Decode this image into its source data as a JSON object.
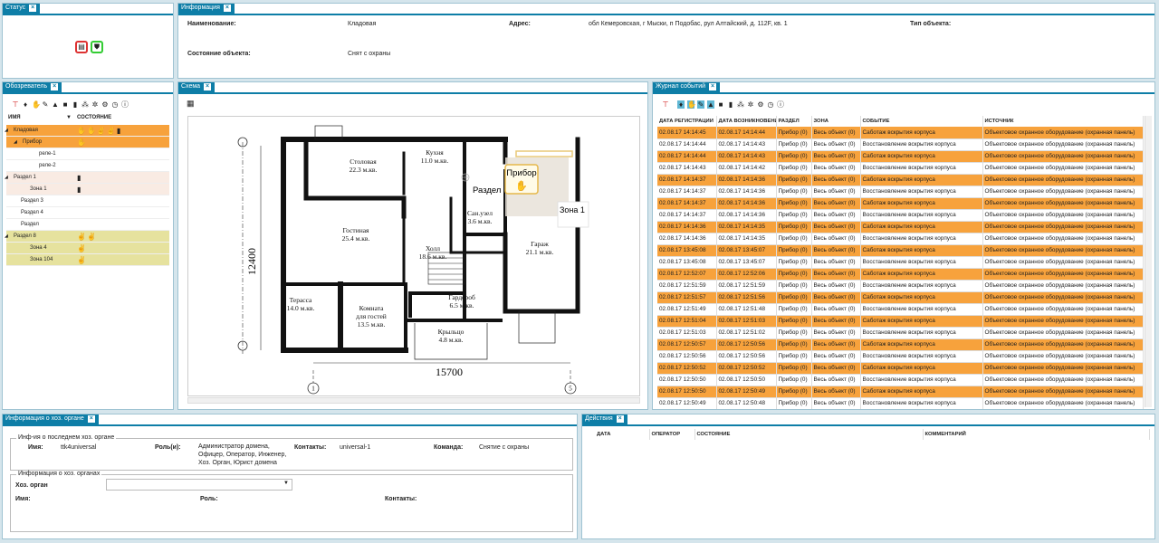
{
  "panels": {
    "status": "Статус",
    "info": "Информация",
    "explorer": "Обозреватель",
    "schema": "Схема",
    "journal": "Журнал событий",
    "host": "Информация о хоз. органе",
    "actions": "Действия"
  },
  "info": {
    "name_label": "Наименование:",
    "name_value": "Кладовая",
    "address_label": "Адрес:",
    "address_value": "обл Кемеровская, г Мыски, п Подобас, рул Алтайский, д. 112F, кв. 1",
    "type_label": "Тип объекта:",
    "state_label": "Состояние объекта:",
    "state_value": "Снят с охраны"
  },
  "tree": {
    "col_name": "ИМЯ",
    "col_state": "СОСТОЯНИЕ",
    "rows": [
      {
        "name": "Кладовая",
        "state": "✋✋✌✌▮",
        "level": 0,
        "bg": "#f7a23c"
      },
      {
        "name": "Прибор",
        "state": "✋",
        "level": 1,
        "bg": "#f7a23c"
      },
      {
        "name": "реле-1",
        "state": "",
        "level": 2,
        "bg": "#ffffff"
      },
      {
        "name": "реле-2",
        "state": "",
        "level": 2,
        "bg": "#ffffff"
      },
      {
        "name": "Раздел 1",
        "state": "▮",
        "level": 0,
        "bg": "#f9ebe3"
      },
      {
        "name": "Зона 1",
        "state": "▮",
        "level": 1,
        "bg": "#f9ebe3"
      },
      {
        "name": "Раздел 3",
        "state": "",
        "level": 0,
        "bg": "#ffffff"
      },
      {
        "name": "Раздел 4",
        "state": "",
        "level": 0,
        "bg": "#ffffff"
      },
      {
        "name": "Раздел",
        "state": "",
        "level": 0,
        "bg": "#ffffff"
      },
      {
        "name": "Раздел 8",
        "state": "✌✌",
        "level": 0,
        "bg": "#e6e29e"
      },
      {
        "name": "Зона 4",
        "state": "✌",
        "level": 1,
        "bg": "#e6e29e"
      },
      {
        "name": "Зона 104",
        "state": "✌",
        "level": 1,
        "bg": "#e6e29e"
      }
    ]
  },
  "plan": {
    "labels": {
      "stolovaya": "Столовая",
      "stolovaya_area": "22.3 м.кв.",
      "kuhnya": "Кухня",
      "kuhnya_area": "11.0 м.кв.",
      "gostinaya": "Гостиная",
      "gostinaya_area": "25.4 м.кв.",
      "sanuzel": "Сан.узел",
      "sanuzel_area": "3.6 м.кв.",
      "holl": "Холл",
      "holl_area": "18.6 м.кв.",
      "garazh": "Гараж",
      "garazh_area": "21.1 м.кв.",
      "terrasa": "Терасса",
      "terrasa_area": "14.0 м.кв.",
      "komnata": "Комната",
      "komnata2": "для гостей",
      "komnata_area": "13.5 м.кв.",
      "garderob": "Гардероб",
      "garderob_area": "6.5 м.кв.",
      "kryltso": "Крыльцо",
      "kryltso_area": "4.8 м.кв.",
      "dim_v": "12400",
      "dim_h": "15700",
      "axis1": "1",
      "axis5": "5"
    },
    "overlay": {
      "pribor": "Прибор",
      "razdel": "Раздел",
      "zona": "Зона 1"
    }
  },
  "journal": {
    "columns": [
      "ДАТА РЕГИСТРАЦИИ",
      "ДАТА ВОЗНИКНОВЕНИЯ",
      "РАЗДЕЛ",
      "ЗОНА",
      "СОБЫТИЕ",
      "ИСТОЧНИК"
    ],
    "rows": [
      {
        "reg": "02.08.17 14:14:45",
        "occ": "02.08.17 14:14:44",
        "razdel": "Прибор (0)",
        "zona": "Весь объект (0)",
        "event": "Саботаж вскрытия корпуса",
        "source": "Объектовое охранное оборудование (охранная панель)"
      },
      {
        "reg": "02.08.17 14:14:44",
        "occ": "02.08.17 14:14:43",
        "razdel": "Прибор (0)",
        "zona": "Весь объект (0)",
        "event": "Восстановление вскрытия корпуса",
        "source": "Объектовое охранное оборудование (охранная панель)"
      },
      {
        "reg": "02.08.17 14:14:44",
        "occ": "02.08.17 14:14:43",
        "razdel": "Прибор (0)",
        "zona": "Весь объект (0)",
        "event": "Саботаж вскрытия корпуса",
        "source": "Объектовое охранное оборудование (охранная панель)"
      },
      {
        "reg": "02.08.17 14:14:43",
        "occ": "02.08.17 14:14:42",
        "razdel": "Прибор (0)",
        "zona": "Весь объект (0)",
        "event": "Восстановление вскрытия корпуса",
        "source": "Объектовое охранное оборудование (охранная панель)"
      },
      {
        "reg": "02.08.17 14:14:37",
        "occ": "02.08.17 14:14:36",
        "razdel": "Прибор (0)",
        "zona": "Весь объект (0)",
        "event": "Саботаж вскрытия корпуса",
        "source": "Объектовое охранное оборудование (охранная панель)"
      },
      {
        "reg": "02.08.17 14:14:37",
        "occ": "02.08.17 14:14:36",
        "razdel": "Прибор (0)",
        "zona": "Весь объект (0)",
        "event": "Восстановление вскрытия корпуса",
        "source": "Объектовое охранное оборудование (охранная панель)"
      },
      {
        "reg": "02.08.17 14:14:37",
        "occ": "02.08.17 14:14:36",
        "razdel": "Прибор (0)",
        "zona": "Весь объект (0)",
        "event": "Саботаж вскрытия корпуса",
        "source": "Объектовое охранное оборудование (охранная панель)"
      },
      {
        "reg": "02.08.17 14:14:37",
        "occ": "02.08.17 14:14:36",
        "razdel": "Прибор (0)",
        "zona": "Весь объект (0)",
        "event": "Восстановление вскрытия корпуса",
        "source": "Объектовое охранное оборудование (охранная панель)"
      },
      {
        "reg": "02.08.17 14:14:36",
        "occ": "02.08.17 14:14:35",
        "razdel": "Прибор (0)",
        "zona": "Весь объект (0)",
        "event": "Саботаж вскрытия корпуса",
        "source": "Объектовое охранное оборудование (охранная панель)"
      },
      {
        "reg": "02.08.17 14:14:36",
        "occ": "02.08.17 14:14:35",
        "razdel": "Прибор (0)",
        "zona": "Весь объект (0)",
        "event": "Восстановление вскрытия корпуса",
        "source": "Объектовое охранное оборудование (охранная панель)"
      },
      {
        "reg": "02.08.17 13:45:08",
        "occ": "02.08.17 13:45:07",
        "razdel": "Прибор (0)",
        "zona": "Весь объект (0)",
        "event": "Саботаж вскрытия корпуса",
        "source": "Объектовое охранное оборудование (охранная панель)"
      },
      {
        "reg": "02.08.17 13:45:08",
        "occ": "02.08.17 13:45:07",
        "razdel": "Прибор (0)",
        "zona": "Весь объект (0)",
        "event": "Восстановление вскрытия корпуса",
        "source": "Объектовое охранное оборудование (охранная панель)"
      },
      {
        "reg": "02.08.17 12:52:07",
        "occ": "02.08.17 12:52:06",
        "razdel": "Прибор (0)",
        "zona": "Весь объект (0)",
        "event": "Саботаж вскрытия корпуса",
        "source": "Объектовое охранное оборудование (охранная панель)"
      },
      {
        "reg": "02.08.17 12:51:59",
        "occ": "02.08.17 12:51:59",
        "razdel": "Прибор (0)",
        "zona": "Весь объект (0)",
        "event": "Восстановление вскрытия корпуса",
        "source": "Объектовое охранное оборудование (охранная панель)"
      },
      {
        "reg": "02.08.17 12:51:57",
        "occ": "02.08.17 12:51:56",
        "razdel": "Прибор (0)",
        "zona": "Весь объект (0)",
        "event": "Саботаж вскрытия корпуса",
        "source": "Объектовое охранное оборудование (охранная панель)"
      },
      {
        "reg": "02.08.17 12:51:49",
        "occ": "02.08.17 12:51:48",
        "razdel": "Прибор (0)",
        "zona": "Весь объект (0)",
        "event": "Восстановление вскрытия корпуса",
        "source": "Объектовое охранное оборудование (охранная панель)"
      },
      {
        "reg": "02.08.17 12:51:04",
        "occ": "02.08.17 12:51:03",
        "razdel": "Прибор (0)",
        "zona": "Весь объект (0)",
        "event": "Саботаж вскрытия корпуса",
        "source": "Объектовое охранное оборудование (охранная панель)"
      },
      {
        "reg": "02.08.17 12:51:03",
        "occ": "02.08.17 12:51:02",
        "razdel": "Прибор (0)",
        "zona": "Весь объект (0)",
        "event": "Восстановление вскрытия корпуса",
        "source": "Объектовое охранное оборудование (охранная панель)"
      },
      {
        "reg": "02.08.17 12:50:57",
        "occ": "02.08.17 12:50:56",
        "razdel": "Прибор (0)",
        "zona": "Весь объект (0)",
        "event": "Саботаж вскрытия корпуса",
        "source": "Объектовое охранное оборудование (охранная панель)"
      },
      {
        "reg": "02.08.17 12:50:56",
        "occ": "02.08.17 12:50:56",
        "razdel": "Прибор (0)",
        "zona": "Весь объект (0)",
        "event": "Восстановление вскрытия корпуса",
        "source": "Объектовое охранное оборудование (охранная панель)"
      },
      {
        "reg": "02.08.17 12:50:52",
        "occ": "02.08.17 12:50:52",
        "razdel": "Прибор (0)",
        "zona": "Весь объект (0)",
        "event": "Саботаж вскрытия корпуса",
        "source": "Объектовое охранное оборудование (охранная панель)"
      },
      {
        "reg": "02.08.17 12:50:50",
        "occ": "02.08.17 12:50:50",
        "razdel": "Прибор (0)",
        "zona": "Весь объект (0)",
        "event": "Восстановление вскрытия корпуса",
        "source": "Объектовое охранное оборудование (охранная панель)"
      },
      {
        "reg": "02.08.17 12:50:50",
        "occ": "02.08.17 12:50:49",
        "razdel": "Прибор (0)",
        "zona": "Весь объект (0)",
        "event": "Саботаж вскрытия корпуса",
        "source": "Объектовое охранное оборудование (охранная панель)"
      },
      {
        "reg": "02.08.17 12:50:49",
        "occ": "02.08.17 12:50:48",
        "razdel": "Прибор (0)",
        "zona": "Весь объект (0)",
        "event": "Восстановление вскрытия корпуса",
        "source": "Объектовое охранное оборудование (охранная панель)"
      }
    ]
  },
  "host": {
    "last_title": "Инф-ия о последнем хоз. органе",
    "name_label": "Имя:",
    "name_value": "ttk4universal",
    "role_label": "Роль(и):",
    "role_value": "Администратор домена, Офицер, Оператор, Инженер, Хоз. Орган, Юрист домена",
    "contacts_label": "Контакты:",
    "contacts_value": "universal-1",
    "command_label": "Команда:",
    "command_value": "Снятие с охраны",
    "list_title": "Информация о хоз. органах",
    "host_label": "Хоз. орган",
    "name2_label": "Имя:",
    "role2_label": "Роль:",
    "contacts2_label": "Контакты:"
  },
  "actions": {
    "columns": [
      "ДАТА",
      "ОПЕРАТОР",
      "СОСТОЯНИЕ",
      "КОММЕНТАРИЙ"
    ]
  },
  "colors": {
    "accent": "#0e7ea7",
    "orange_row": "#f7a23c",
    "yellow_row": "#e6e29e"
  }
}
